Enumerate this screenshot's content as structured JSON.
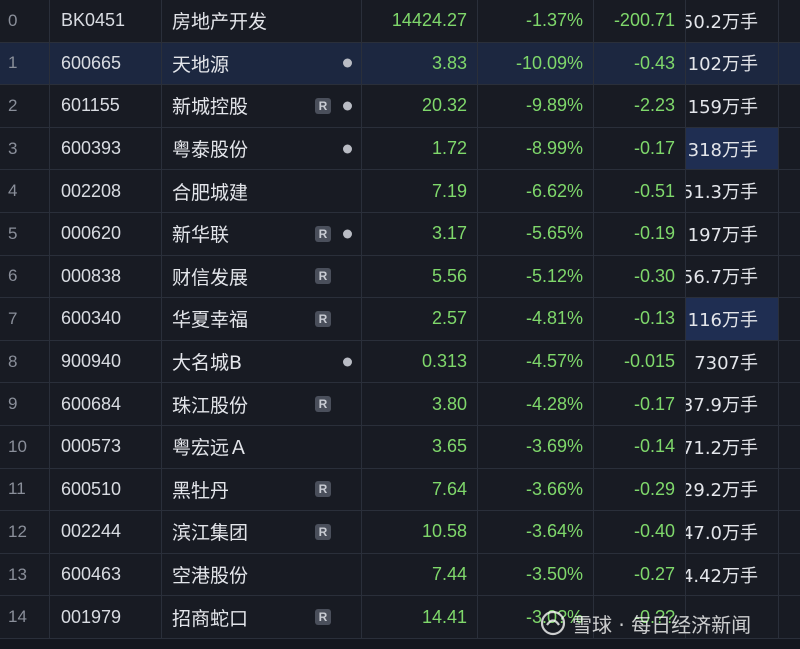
{
  "table": {
    "rows": [
      {
        "idx": "0",
        "code": "BK0451",
        "name": "房地产开发",
        "price": "14424.27",
        "pct": "-1.37%",
        "chg": "-200.71",
        "vol": "50.2万手",
        "r": false,
        "dot": false,
        "selected": false,
        "vol_highlight": false
      },
      {
        "idx": "1",
        "code": "600665",
        "name": "天地源",
        "price": "3.83",
        "pct": "-10.09%",
        "chg": "-0.43",
        "vol": "102万手",
        "r": false,
        "dot": true,
        "selected": true,
        "vol_highlight": false
      },
      {
        "idx": "2",
        "code": "601155",
        "name": "新城控股",
        "price": "20.32",
        "pct": "-9.89%",
        "chg": "-2.23",
        "vol": "159万手",
        "r": true,
        "dot": true,
        "selected": false,
        "vol_highlight": false
      },
      {
        "idx": "3",
        "code": "600393",
        "name": "粤泰股份",
        "price": "1.72",
        "pct": "-8.99%",
        "chg": "-0.17",
        "vol": "318万手",
        "r": false,
        "dot": true,
        "selected": false,
        "vol_highlight": true
      },
      {
        "idx": "4",
        "code": "002208",
        "name": "合肥城建",
        "price": "7.19",
        "pct": "-6.62%",
        "chg": "-0.51",
        "vol": "51.3万手",
        "r": false,
        "dot": false,
        "selected": false,
        "vol_highlight": false
      },
      {
        "idx": "5",
        "code": "000620",
        "name": "新华联",
        "price": "3.17",
        "pct": "-5.65%",
        "chg": "-0.19",
        "vol": "197万手",
        "r": true,
        "dot": true,
        "selected": false,
        "vol_highlight": false
      },
      {
        "idx": "6",
        "code": "000838",
        "name": "财信发展",
        "price": "5.56",
        "pct": "-5.12%",
        "chg": "-0.30",
        "vol": "56.7万手",
        "r": true,
        "dot": false,
        "selected": false,
        "vol_highlight": false
      },
      {
        "idx": "7",
        "code": "600340",
        "name": "华夏幸福",
        "price": "2.57",
        "pct": "-4.81%",
        "chg": "-0.13",
        "vol": "116万手",
        "r": true,
        "dot": false,
        "selected": false,
        "vol_highlight": true
      },
      {
        "idx": "8",
        "code": "900940",
        "name": "大名城B",
        "price": "0.313",
        "pct": "-4.57%",
        "chg": "-0.015",
        "vol": "7307手",
        "r": false,
        "dot": true,
        "selected": false,
        "vol_highlight": false
      },
      {
        "idx": "9",
        "code": "600684",
        "name": "珠江股份",
        "price": "3.80",
        "pct": "-4.28%",
        "chg": "-0.17",
        "vol": "37.9万手",
        "r": true,
        "dot": false,
        "selected": false,
        "vol_highlight": false
      },
      {
        "idx": "10",
        "code": "000573",
        "name": "粤宏远Ａ",
        "price": "3.65",
        "pct": "-3.69%",
        "chg": "-0.14",
        "vol": "71.2万手",
        "r": false,
        "dot": false,
        "selected": false,
        "vol_highlight": false
      },
      {
        "idx": "11",
        "code": "600510",
        "name": "黑牡丹",
        "price": "7.64",
        "pct": "-3.66%",
        "chg": "-0.29",
        "vol": "29.2万手",
        "r": true,
        "dot": false,
        "selected": false,
        "vol_highlight": false
      },
      {
        "idx": "12",
        "code": "002244",
        "name": "滨江集团",
        "price": "10.58",
        "pct": "-3.64%",
        "chg": "-0.40",
        "vol": "47.0万手",
        "r": true,
        "dot": false,
        "selected": false,
        "vol_highlight": false
      },
      {
        "idx": "13",
        "code": "600463",
        "name": "空港股份",
        "price": "7.44",
        "pct": "-3.50%",
        "chg": "-0.27",
        "vol": "4.42万手",
        "r": false,
        "dot": false,
        "selected": false,
        "vol_highlight": false
      },
      {
        "idx": "14",
        "code": "001979",
        "name": "招商蛇口",
        "price": "14.41",
        "pct": "-3.0?%",
        "chg": "-0.??",
        "vol": "",
        "r": true,
        "dot": false,
        "selected": false,
        "vol_highlight": false
      }
    ],
    "badge_label": "R"
  },
  "watermark": {
    "text": "雪球 · 每日经济新闻",
    "icon": "snowball-logo-icon"
  },
  "colors": {
    "down_green": "#7fd86b",
    "selected_row": "#1c2740",
    "vol_highlight": "#1f2e52",
    "background": "#181b23"
  }
}
